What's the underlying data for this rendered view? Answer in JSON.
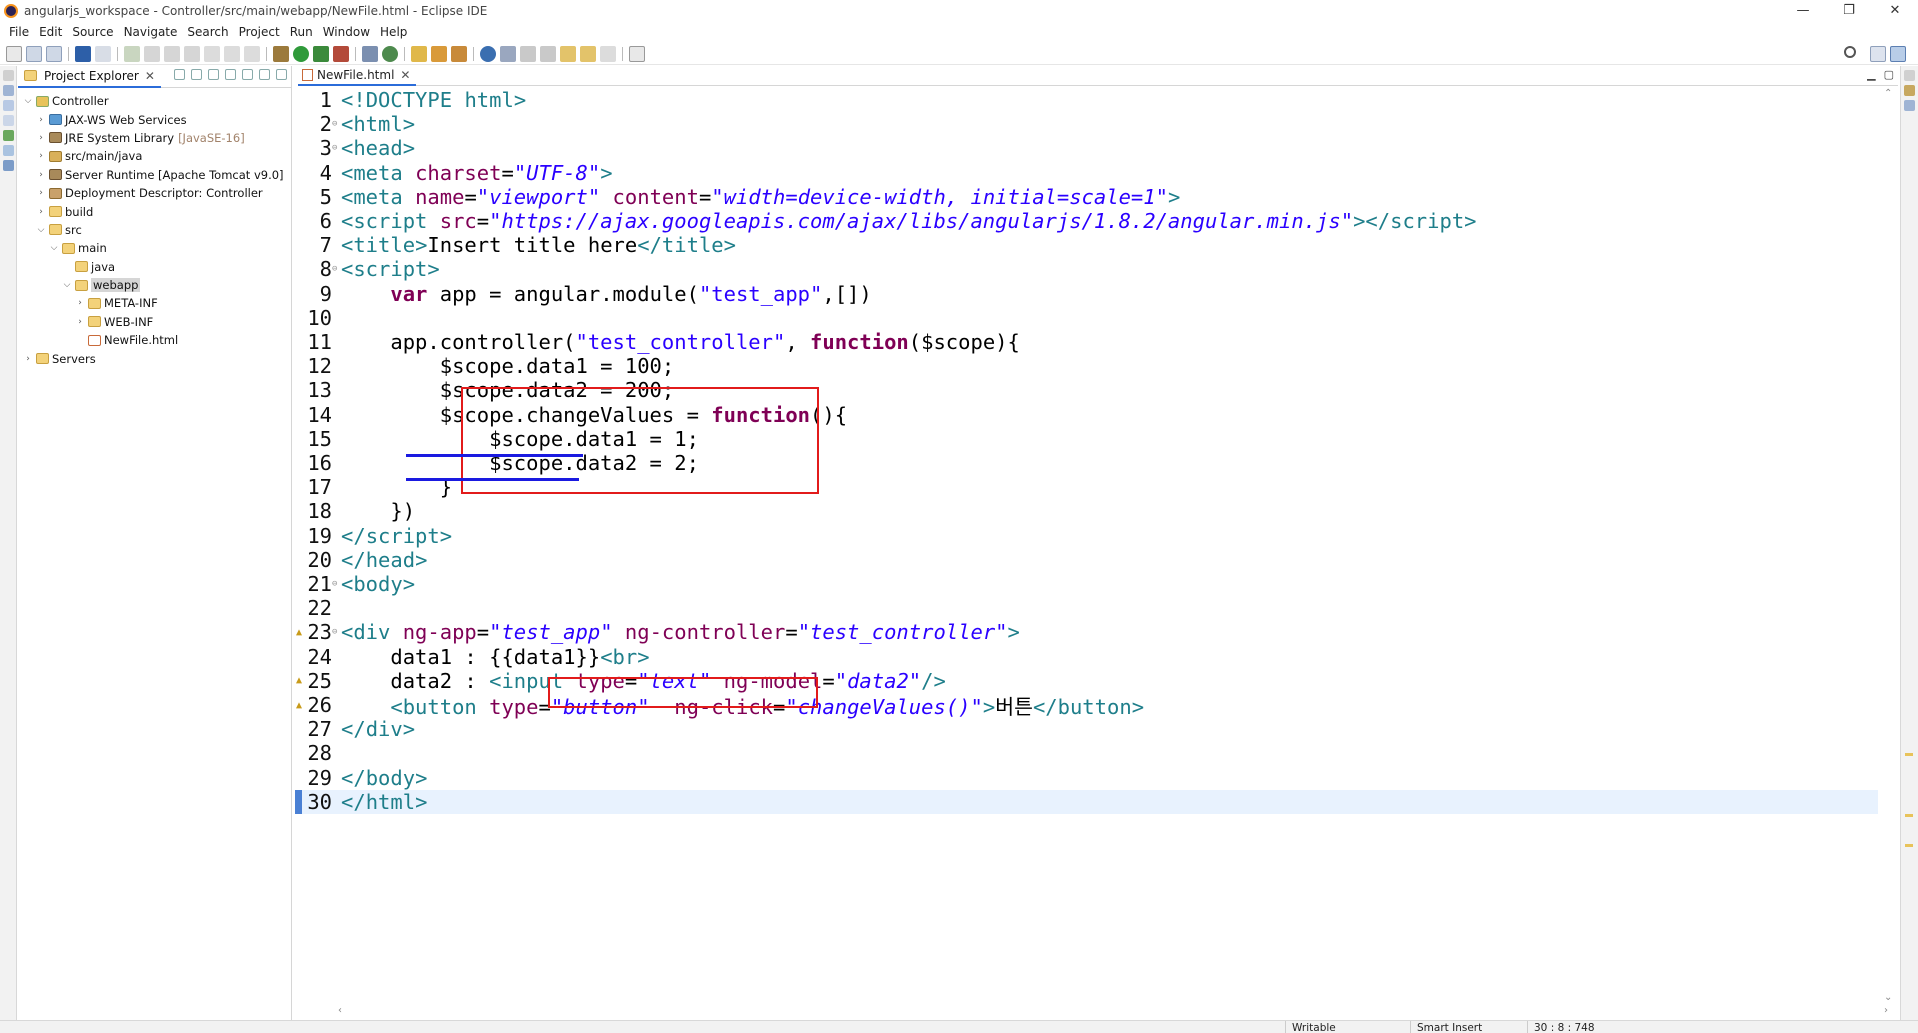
{
  "window": {
    "title": "angularjs_workspace - Controller/src/main/webapp/NewFile.html - Eclipse IDE",
    "controls": [
      "—",
      "❐",
      "✕"
    ]
  },
  "menu": [
    "File",
    "Edit",
    "Source",
    "Navigate",
    "Search",
    "Project",
    "Run",
    "Window",
    "Help"
  ],
  "explorer": {
    "tab_label": "Project Explorer",
    "close": "✕",
    "tree": [
      {
        "label": "Controller",
        "icon": "project-icon",
        "depth": 0,
        "twisty": "open"
      },
      {
        "label": "JAX-WS Web Services",
        "icon": "webservice-icon",
        "depth": 1,
        "twisty": "closed"
      },
      {
        "label": "JRE System Library",
        "suffix": "[JavaSE-16]",
        "icon": "library-icon",
        "depth": 1,
        "twisty": "closed"
      },
      {
        "label": "src/main/java",
        "icon": "package-folder-icon",
        "depth": 1,
        "twisty": "closed"
      },
      {
        "label": "Server Runtime [Apache Tomcat v9.0]",
        "icon": "library-icon",
        "depth": 1,
        "twisty": "closed"
      },
      {
        "label": "Deployment Descriptor: Controller",
        "icon": "deployment-icon",
        "depth": 1,
        "twisty": "closed"
      },
      {
        "label": "build",
        "icon": "folder-icon",
        "depth": 1,
        "twisty": "closed"
      },
      {
        "label": "src",
        "icon": "folder-icon",
        "depth": 1,
        "twisty": "open"
      },
      {
        "label": "main",
        "icon": "folder-icon",
        "depth": 2,
        "twisty": "open"
      },
      {
        "label": "java",
        "icon": "folder-icon",
        "depth": 3,
        "twisty": "none"
      },
      {
        "label": "webapp",
        "icon": "folder-icon",
        "depth": 3,
        "twisty": "open",
        "selected": true
      },
      {
        "label": "META-INF",
        "icon": "folder-icon",
        "depth": 4,
        "twisty": "closed"
      },
      {
        "label": "WEB-INF",
        "icon": "folder-icon",
        "depth": 4,
        "twisty": "closed"
      },
      {
        "label": "NewFile.html",
        "icon": "html-file-icon",
        "depth": 4,
        "twisty": "none"
      },
      {
        "label": "Servers",
        "icon": "folder-icon",
        "depth": 0,
        "twisty": "closed"
      }
    ]
  },
  "editor": {
    "tab_label": "NewFile.html",
    "close": "✕",
    "current_line": 30,
    "lines": [
      {
        "n": "1",
        "fold": "",
        "warn": false,
        "tokens": [
          [
            "ang",
            "<!"
          ],
          [
            "tag",
            "DOCTYPE"
          ],
          [
            "plain",
            " "
          ],
          [
            "tag",
            "html"
          ],
          [
            "ang",
            ">"
          ]
        ]
      },
      {
        "n": "2",
        "fold": "⊖",
        "warn": false,
        "tokens": [
          [
            "ang",
            "<"
          ],
          [
            "tag",
            "html"
          ],
          [
            "ang",
            ">"
          ]
        ]
      },
      {
        "n": "3",
        "fold": "⊖",
        "warn": false,
        "tokens": [
          [
            "ang",
            "<"
          ],
          [
            "tag",
            "head"
          ],
          [
            "ang",
            ">"
          ]
        ]
      },
      {
        "n": "4",
        "fold": "",
        "warn": false,
        "tokens": [
          [
            "ang",
            "<"
          ],
          [
            "tag",
            "meta"
          ],
          [
            "plain",
            " "
          ],
          [
            "attr",
            "charset"
          ],
          [
            "plain",
            "="
          ],
          [
            "str",
            "\"UTF-8\""
          ],
          [
            "ang",
            ">"
          ]
        ]
      },
      {
        "n": "5",
        "fold": "",
        "warn": false,
        "tokens": [
          [
            "ang",
            "<"
          ],
          [
            "tag",
            "meta"
          ],
          [
            "plain",
            " "
          ],
          [
            "attr",
            "name"
          ],
          [
            "plain",
            "="
          ],
          [
            "str",
            "\"viewport\""
          ],
          [
            "plain",
            " "
          ],
          [
            "attr",
            "content"
          ],
          [
            "plain",
            "="
          ],
          [
            "str",
            "\"width=device-width, initial=scale=1\""
          ],
          [
            "ang",
            ">"
          ]
        ]
      },
      {
        "n": "6",
        "fold": "",
        "warn": false,
        "tokens": [
          [
            "ang",
            "<"
          ],
          [
            "tag",
            "script"
          ],
          [
            "plain",
            " "
          ],
          [
            "attr",
            "src"
          ],
          [
            "plain",
            "="
          ],
          [
            "str",
            "\"https://ajax.googleapis.com/ajax/libs/angularjs/1.8.2/angular.min.js\""
          ],
          [
            "ang",
            "></"
          ],
          [
            "tag",
            "script"
          ],
          [
            "ang",
            ">"
          ]
        ]
      },
      {
        "n": "7",
        "fold": "",
        "warn": false,
        "tokens": [
          [
            "ang",
            "<"
          ],
          [
            "tag",
            "title"
          ],
          [
            "ang",
            ">"
          ],
          [
            "plain",
            "Insert title here"
          ],
          [
            "ang",
            "</"
          ],
          [
            "tag",
            "title"
          ],
          [
            "ang",
            ">"
          ]
        ]
      },
      {
        "n": "8",
        "fold": "⊖",
        "warn": false,
        "tokens": [
          [
            "ang",
            "<"
          ],
          [
            "tag",
            "script"
          ],
          [
            "ang",
            ">"
          ]
        ]
      },
      {
        "n": "9",
        "fold": "",
        "warn": false,
        "tokens": [
          [
            "plain",
            "    "
          ],
          [
            "kw",
            "var"
          ],
          [
            "plain",
            " app = angular.module("
          ],
          [
            "jsstr",
            "\"test_app\""
          ],
          [
            "plain",
            ",[])"
          ]
        ]
      },
      {
        "n": "10",
        "fold": "",
        "warn": false,
        "tokens": []
      },
      {
        "n": "11",
        "fold": "",
        "warn": false,
        "tokens": [
          [
            "plain",
            "    app.controller("
          ],
          [
            "jsstr",
            "\"test_controller\""
          ],
          [
            "plain",
            ", "
          ],
          [
            "kw",
            "function"
          ],
          [
            "plain",
            "($scope){"
          ]
        ]
      },
      {
        "n": "12",
        "fold": "",
        "warn": false,
        "tokens": [
          [
            "plain",
            "        $scope.data1 = 100;"
          ]
        ]
      },
      {
        "n": "13",
        "fold": "",
        "warn": false,
        "tokens": [
          [
            "plain",
            "        $scope.data2 = 200;"
          ]
        ]
      },
      {
        "n": "14",
        "fold": "",
        "warn": false,
        "tokens": [
          [
            "plain",
            "        $scope.changeValues = "
          ],
          [
            "kw",
            "function"
          ],
          [
            "plain",
            "(){"
          ]
        ]
      },
      {
        "n": "15",
        "fold": "",
        "warn": false,
        "tokens": [
          [
            "plain",
            "            $scope.data1 = 1;"
          ]
        ]
      },
      {
        "n": "16",
        "fold": "",
        "warn": false,
        "tokens": [
          [
            "plain",
            "            $scope.data2 = 2;"
          ]
        ]
      },
      {
        "n": "17",
        "fold": "",
        "warn": false,
        "tokens": [
          [
            "plain",
            "        }"
          ]
        ]
      },
      {
        "n": "18",
        "fold": "",
        "warn": false,
        "tokens": [
          [
            "plain",
            "    })"
          ]
        ]
      },
      {
        "n": "19",
        "fold": "",
        "warn": false,
        "tokens": [
          [
            "ang",
            "</"
          ],
          [
            "tag",
            "script"
          ],
          [
            "ang",
            ">"
          ]
        ]
      },
      {
        "n": "20",
        "fold": "",
        "warn": false,
        "tokens": [
          [
            "ang",
            "</"
          ],
          [
            "tag",
            "head"
          ],
          [
            "ang",
            ">"
          ]
        ]
      },
      {
        "n": "21",
        "fold": "⊖",
        "warn": false,
        "tokens": [
          [
            "ang",
            "<"
          ],
          [
            "tag",
            "body"
          ],
          [
            "ang",
            ">"
          ]
        ]
      },
      {
        "n": "22",
        "fold": "",
        "warn": false,
        "tokens": []
      },
      {
        "n": "23",
        "fold": "⊖",
        "warn": true,
        "tokens": [
          [
            "ang",
            "<"
          ],
          [
            "tag",
            "div"
          ],
          [
            "plain",
            " "
          ],
          [
            "attr",
            "ng-app"
          ],
          [
            "plain",
            "="
          ],
          [
            "str",
            "\"test_app\""
          ],
          [
            "plain",
            " "
          ],
          [
            "attr",
            "ng-controller"
          ],
          [
            "plain",
            "="
          ],
          [
            "str",
            "\"test_controller\""
          ],
          [
            "ang",
            ">"
          ]
        ]
      },
      {
        "n": "24",
        "fold": "",
        "warn": false,
        "tokens": [
          [
            "plain",
            "    data1 : {{data1}}"
          ],
          [
            "ang",
            "<"
          ],
          [
            "tag",
            "br"
          ],
          [
            "ang",
            ">"
          ]
        ]
      },
      {
        "n": "25",
        "fold": "",
        "warn": true,
        "tokens": [
          [
            "plain",
            "    data2 : "
          ],
          [
            "ang",
            "<"
          ],
          [
            "tag",
            "input"
          ],
          [
            "plain",
            " "
          ],
          [
            "attr",
            "type"
          ],
          [
            "plain",
            "="
          ],
          [
            "str",
            "\"text\""
          ],
          [
            "plain",
            " "
          ],
          [
            "attr",
            "ng-model"
          ],
          [
            "plain",
            "="
          ],
          [
            "str",
            "\"data2\""
          ],
          [
            "ang",
            "/>"
          ]
        ]
      },
      {
        "n": "26",
        "fold": "",
        "warn": true,
        "tokens": [
          [
            "plain",
            "    "
          ],
          [
            "ang",
            "<"
          ],
          [
            "tag",
            "button"
          ],
          [
            "plain",
            " "
          ],
          [
            "attr",
            "type"
          ],
          [
            "plain",
            "="
          ],
          [
            "str",
            "\"button\""
          ],
          [
            "plain",
            "  "
          ],
          [
            "attr",
            "ng-click"
          ],
          [
            "plain",
            "="
          ],
          [
            "str",
            "\"changeValues()\""
          ],
          [
            "ang",
            ">"
          ],
          [
            "plain",
            "버튼"
          ],
          [
            "ang",
            "</"
          ],
          [
            "tag",
            "button"
          ],
          [
            "ang",
            ">"
          ]
        ]
      },
      {
        "n": "27",
        "fold": "",
        "warn": false,
        "tokens": [
          [
            "ang",
            "</"
          ],
          [
            "tag",
            "div"
          ],
          [
            "ang",
            ">"
          ]
        ]
      },
      {
        "n": "28",
        "fold": "",
        "warn": false,
        "tokens": []
      },
      {
        "n": "29",
        "fold": "",
        "warn": false,
        "tokens": [
          [
            "ang",
            "</"
          ],
          [
            "tag",
            "body"
          ],
          [
            "ang",
            ">"
          ]
        ]
      },
      {
        "n": "30",
        "fold": "",
        "warn": false,
        "tokens": [
          [
            "ang",
            "</"
          ],
          [
            "tag",
            "html"
          ],
          [
            "ang",
            ">"
          ]
        ]
      }
    ]
  },
  "status": {
    "writable": "Writable",
    "insert_mode": "Smart Insert",
    "position": "30 : 8 : 748"
  },
  "colors": {
    "annotation_box": "#e21b1b",
    "annotation_underline": "#1a1ae0",
    "tag": "#1e7e8a",
    "attribute": "#7f0055",
    "string": "#2a00ff",
    "keyword": "#7f0055"
  }
}
